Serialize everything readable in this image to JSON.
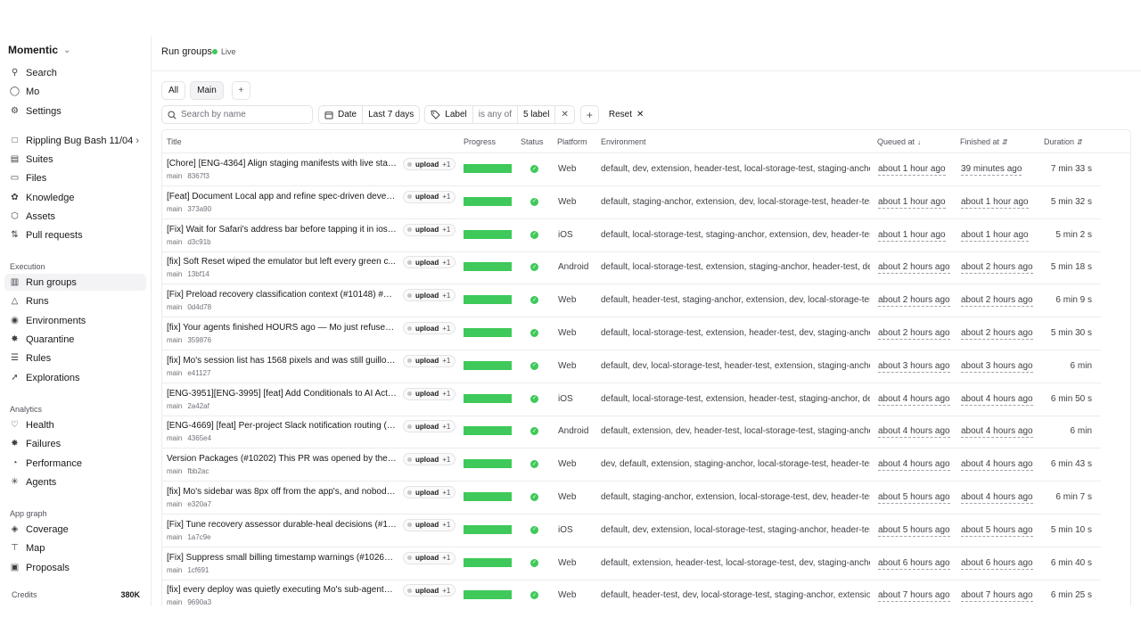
{
  "sidebar": {
    "workspace": "Momentic",
    "top_items": [
      {
        "label": "Search",
        "icon": "search-icon"
      },
      {
        "label": "Mo",
        "icon": "chat-icon"
      },
      {
        "label": "Settings",
        "icon": "gear-icon"
      }
    ],
    "project_items": [
      {
        "label": "Rippling Bug Bash 11/04",
        "icon": "folder-icon"
      },
      {
        "label": "Suites",
        "icon": "book-icon"
      },
      {
        "label": "Files",
        "icon": "file-icon"
      },
      {
        "label": "Knowledge",
        "icon": "brain-icon"
      },
      {
        "label": "Assets",
        "icon": "box-icon"
      },
      {
        "label": "Pull requests",
        "icon": "pull-request-icon"
      }
    ],
    "execution_title": "Execution",
    "execution_items": [
      {
        "label": "Run groups",
        "icon": "columns-icon"
      },
      {
        "label": "Runs",
        "icon": "flask-icon"
      },
      {
        "label": "Environments",
        "icon": "globe-icon"
      },
      {
        "label": "Quarantine",
        "icon": "bug-icon"
      },
      {
        "label": "Rules",
        "icon": "list-icon"
      },
      {
        "label": "Explorations",
        "icon": "telescope-icon"
      }
    ],
    "analytics_title": "Analytics",
    "analytics_items": [
      {
        "label": "Health",
        "icon": "heart-pulse-icon"
      },
      {
        "label": "Failures",
        "icon": "bug-icon"
      },
      {
        "label": "Performance",
        "icon": "gauge-icon"
      },
      {
        "label": "Agents",
        "icon": "agent-icon"
      }
    ],
    "appgraph_title": "App graph",
    "appgraph_items": [
      {
        "label": "Coverage",
        "icon": "coverage-icon"
      },
      {
        "label": "Map",
        "icon": "map-icon"
      },
      {
        "label": "Proposals",
        "icon": "inbox-icon"
      }
    ],
    "credits_label": "Credits",
    "credits_value": "380K"
  },
  "header": {
    "title": "Run groups",
    "live_label": "Live"
  },
  "tabs": {
    "all": "All",
    "main": "Main"
  },
  "filters": {
    "search_placeholder": "Search by name",
    "date_label": "Date",
    "date_value": "Last 7 days",
    "label_label": "Label",
    "label_op": "is any of",
    "label_value": "5 label",
    "reset_label": "Reset"
  },
  "table": {
    "columns": {
      "title": "Title",
      "progress": "Progress",
      "status": "Status",
      "platform": "Platform",
      "environment": "Environment",
      "queued": "Queued at",
      "finished": "Finished at",
      "duration": "Duration"
    },
    "status_color": "#3ec95a",
    "rows": [
      {
        "title": "[Chore] [ENG-4364] Align staging manifests with live stat...",
        "branch": "main",
        "hash": "8367f3",
        "tag": "upload",
        "tag_count": "+1",
        "progress": 1.0,
        "platform": "Web",
        "environment": "default, dev, extension, header-test, local-storage-test, staging-anchor",
        "queued": "about 1 hour ago",
        "finished": "39 minutes ago",
        "duration": "7 min 33 s"
      },
      {
        "title": "[Feat] Document Local app and refine spec-driven develo...",
        "branch": "main",
        "hash": "373a90",
        "tag": "upload",
        "tag_count": "+1",
        "progress": 1.0,
        "platform": "Web",
        "environment": "default, staging-anchor, extension, dev, local-storage-test, header-test",
        "queued": "about 1 hour ago",
        "finished": "about 1 hour ago",
        "duration": "5 min 32 s"
      },
      {
        "title": "[Fix] Wait for Safari's address bar before tapping it in ios-...",
        "branch": "main",
        "hash": "d3c91b",
        "tag": "upload",
        "tag_count": "+1",
        "progress": 1.0,
        "platform": "iOS",
        "environment": "default, local-storage-test, staging-anchor, extension, dev, header-test",
        "queued": "about 1 hour ago",
        "finished": "about 1 hour ago",
        "duration": "5 min 2 s"
      },
      {
        "title": "[fix] Soft Reset wiped the emulator but left every green c...",
        "branch": "main",
        "hash": "13bf14",
        "tag": "upload",
        "tag_count": "+1",
        "progress": 1.0,
        "platform": "Android",
        "environment": "default, local-storage-test, extension, staging-anchor, header-test, dev",
        "queued": "about 2 hours ago",
        "finished": "about 2 hours ago",
        "duration": "5 min 18 s"
      },
      {
        "title": "[Fix] Preload recovery classification context (#10148) ## S...",
        "branch": "main",
        "hash": "0d4d78",
        "tag": "upload",
        "tag_count": "+1",
        "progress": 1.0,
        "platform": "Web",
        "environment": "default, header-test, staging-anchor, extension, dev, local-storage-test",
        "queued": "about 2 hours ago",
        "finished": "about 2 hours ago",
        "duration": "6 min 9 s"
      },
      {
        "title": "[fix] Your agents finished HOURS ago — Mo just refused t...",
        "branch": "main",
        "hash": "359876",
        "tag": "upload",
        "tag_count": "+1",
        "progress": 1.0,
        "platform": "Web",
        "environment": "default, local-storage-test, extension, header-test, dev, staging-anchor",
        "queued": "about 2 hours ago",
        "finished": "about 2 hours ago",
        "duration": "5 min 30 s"
      },
      {
        "title": "[fix] Mo's session list has 1568 pixels and was still guilloti...",
        "branch": "main",
        "hash": "e41127",
        "tag": "upload",
        "tag_count": "+1",
        "progress": 1.0,
        "platform": "Web",
        "environment": "default, dev, local-storage-test, header-test, extension, staging-anchor",
        "queued": "about 3 hours ago",
        "finished": "about 3 hours ago",
        "duration": "6 min"
      },
      {
        "title": "[ENG-3951][ENG-3995] [feat] Add Conditionals to AI Acti...",
        "branch": "main",
        "hash": "2a42af",
        "tag": "upload",
        "tag_count": "+1",
        "progress": 1.0,
        "platform": "iOS",
        "environment": "default, local-storage-test, extension, header-test, staging-anchor, dev",
        "queued": "about 4 hours ago",
        "finished": "about 4 hours ago",
        "duration": "6 min 50 s"
      },
      {
        "title": "[ENG-4669] [feat] Per-project Slack notification routing (#...",
        "branch": "main",
        "hash": "4365e4",
        "tag": "upload",
        "tag_count": "+1",
        "progress": 1.0,
        "platform": "Android",
        "environment": "default, extension, dev, header-test, local-storage-test, staging-anchor",
        "queued": "about 4 hours ago",
        "finished": "about 4 hours ago",
        "duration": "6 min"
      },
      {
        "title": "Version Packages (#10202) This PR was opened by the [C...",
        "branch": "main",
        "hash": "fbb2ac",
        "tag": "upload",
        "tag_count": "+1",
        "progress": 1.0,
        "platform": "Web",
        "environment": "dev, default, extension, staging-anchor, local-storage-test, header-test",
        "queued": "about 4 hours ago",
        "finished": "about 4 hours ago",
        "duration": "6 min 43 s"
      },
      {
        "title": "[fix] Mo's sidebar was 8px off from the app's, and nobody ...",
        "branch": "main",
        "hash": "e320a7",
        "tag": "upload",
        "tag_count": "+1",
        "progress": 1.0,
        "platform": "Web",
        "environment": "default, staging-anchor, extension, local-storage-test, dev, header-test",
        "queued": "about 5 hours ago",
        "finished": "about 4 hours ago",
        "duration": "6 min 7 s"
      },
      {
        "title": "[Fix] Tune recovery assessor durable-heal decisions (#101...",
        "branch": "main",
        "hash": "1a7c9e",
        "tag": "upload",
        "tag_count": "+1",
        "progress": 1.0,
        "platform": "iOS",
        "environment": "default, dev, extension, local-storage-test, staging-anchor, header-test",
        "queued": "about 5 hours ago",
        "finished": "about 5 hours ago",
        "duration": "5 min 10 s"
      },
      {
        "title": "[Fix] Suppress small billing timestamp warnings (#10267) ...",
        "branch": "main",
        "hash": "1cf691",
        "tag": "upload",
        "tag_count": "+1",
        "progress": 1.0,
        "platform": "Web",
        "environment": "default, extension, header-test, local-storage-test, dev, staging-anchor",
        "queued": "about 6 hours ago",
        "finished": "about 6 hours ago",
        "duration": "6 min 40 s"
      },
      {
        "title": "[fix] every deploy was quietly executing Mo's sub-agents ...",
        "branch": "main",
        "hash": "9690a3",
        "tag": "upload",
        "tag_count": "+1",
        "progress": 1.0,
        "platform": "Web",
        "environment": "default, header-test, dev, local-storage-test, staging-anchor, extension",
        "queued": "about 7 hours ago",
        "finished": "about 7 hours ago",
        "duration": "6 min 25 s"
      }
    ]
  }
}
